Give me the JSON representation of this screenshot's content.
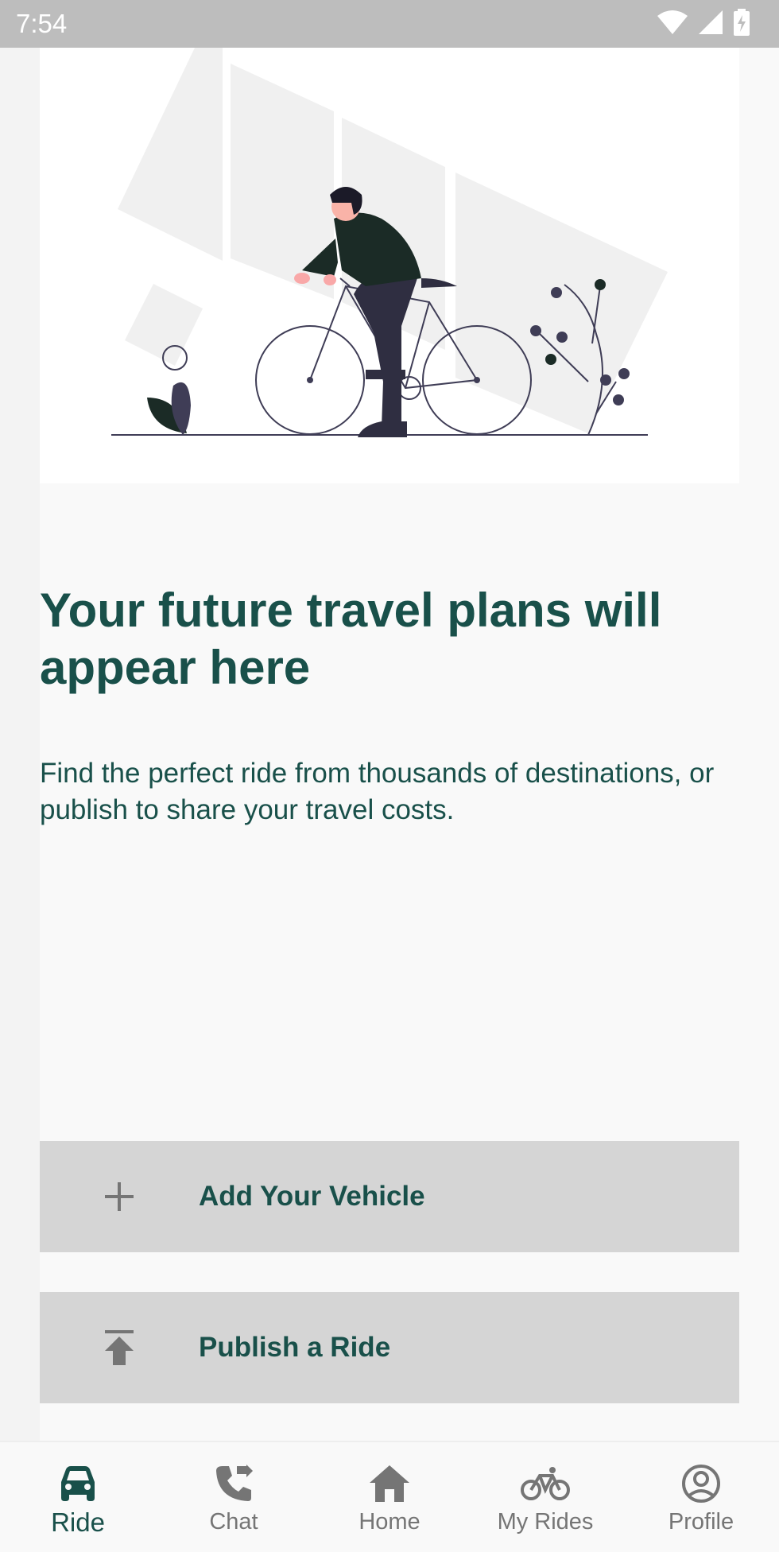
{
  "status_bar": {
    "time": "7:54",
    "icons": [
      "wifi-icon",
      "signal-icon",
      "battery-charging-icon"
    ]
  },
  "illustration": {
    "subject": "person-riding-bicycle-illustration"
  },
  "empty_state": {
    "title": "Your future travel plans will appear here",
    "description": "Find the perfect ride from thousands of destinations, or publish to share your travel costs."
  },
  "actions": {
    "add_vehicle": {
      "label": "Add Your Vehicle",
      "icon": "plus-icon"
    },
    "publish_ride": {
      "label": "Publish a Ride",
      "icon": "upload-icon"
    }
  },
  "bottom_nav": {
    "items": [
      {
        "label": "Ride",
        "icon": "car-icon",
        "active": true
      },
      {
        "label": "Chat",
        "icon": "phone-forward-icon",
        "active": false
      },
      {
        "label": "Home",
        "icon": "home-icon",
        "active": false
      },
      {
        "label": "My Rides",
        "icon": "bicycle-icon",
        "active": false
      },
      {
        "label": "Profile",
        "icon": "account-circle-icon",
        "active": false
      }
    ]
  },
  "colors": {
    "primary": "#19504a",
    "status_bar": "#bdbdbd",
    "button_bg": "#d5d5d5",
    "background": "#f9f9f9",
    "inactive": "#757575"
  }
}
